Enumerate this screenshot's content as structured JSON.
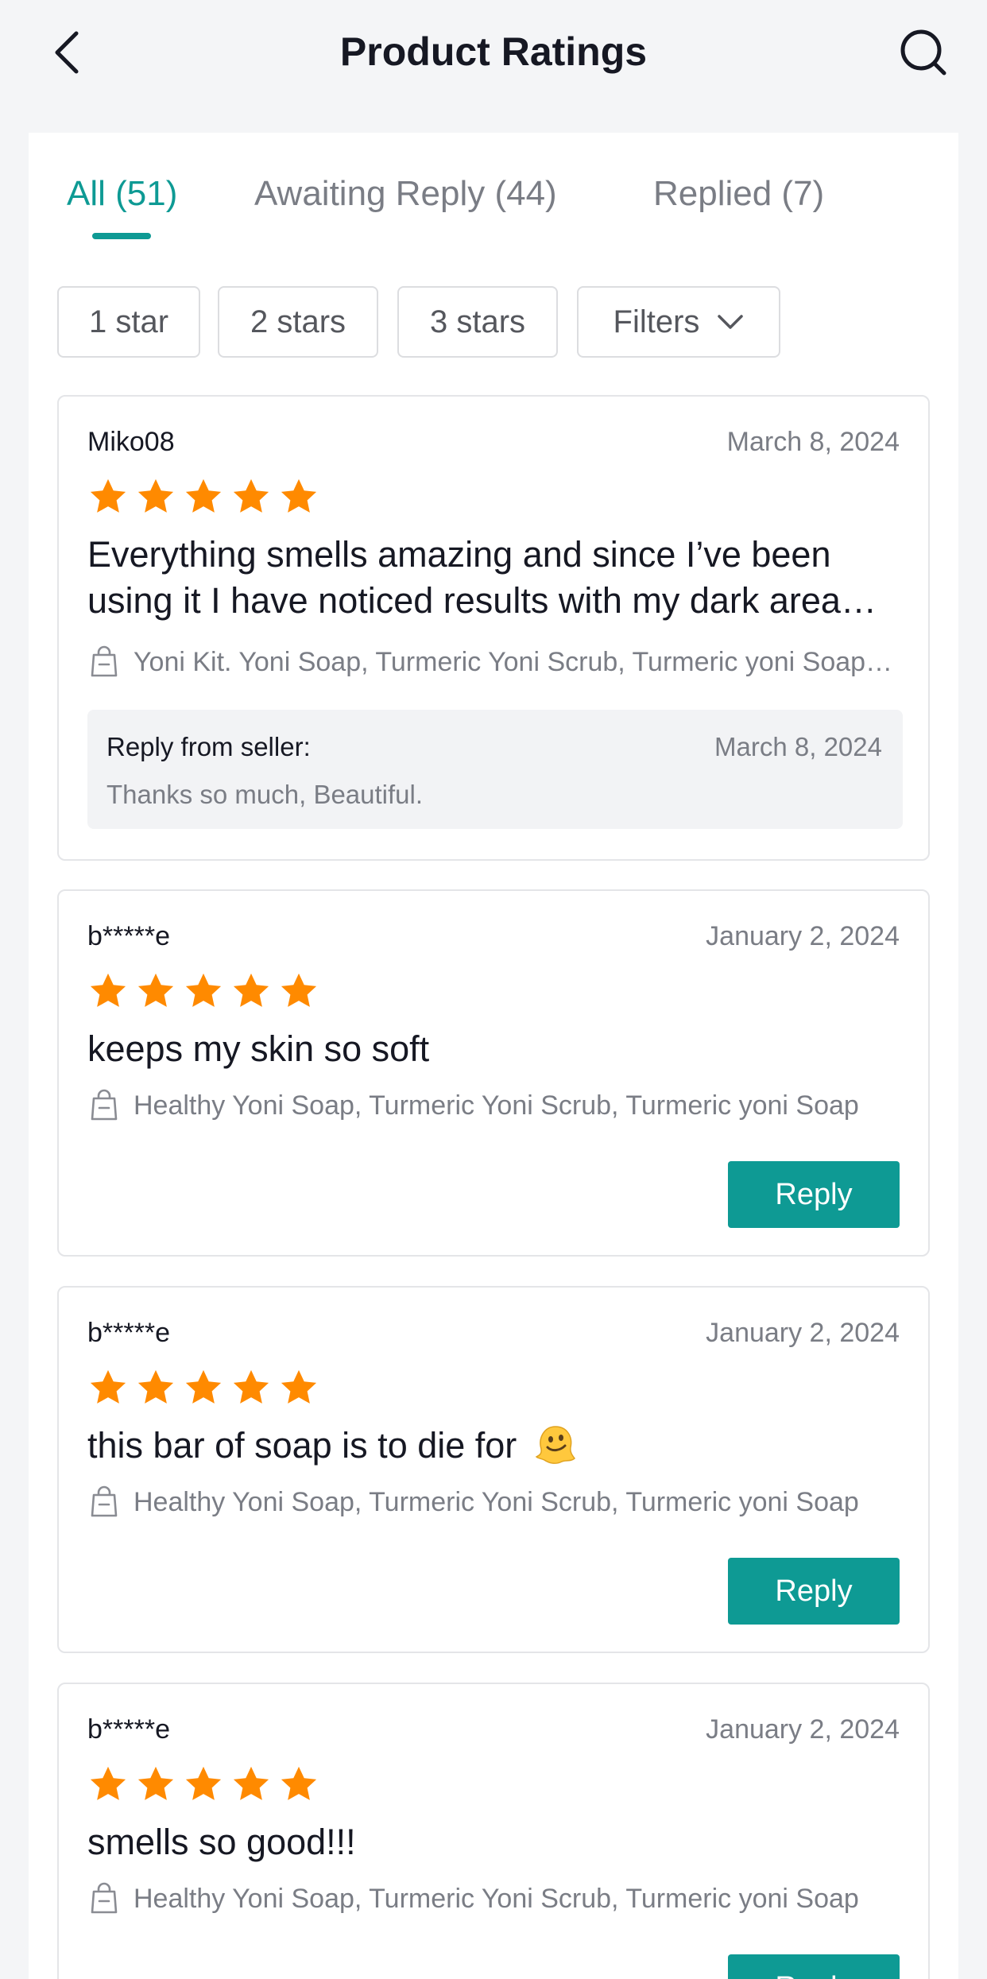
{
  "header": {
    "title": "Product Ratings",
    "back_icon": "chevron-left-icon",
    "search_icon": "search-icon"
  },
  "tabs": [
    {
      "label": "All (51)",
      "active": true
    },
    {
      "label": "Awaiting Reply (44)",
      "active": false
    },
    {
      "label": "Replied (7)",
      "active": false
    }
  ],
  "chips": [
    {
      "label": "1 star"
    },
    {
      "label": "2 stars"
    },
    {
      "label": "3 stars"
    },
    {
      "label": "Filters"
    }
  ],
  "colors": {
    "accent": "#0e9a94",
    "star": "#ff8a00",
    "muted_text": "#7a7d85"
  },
  "reviews": [
    {
      "user": "Miko08",
      "date": "March 8, 2024",
      "rating": 5,
      "text": "Everything smells amazing and since I’ve been using it I have noticed results with my dark area…",
      "products": "Yoni Kit.  Yoni Soap, Turmeric Yoni Scrub, Turmeric yoni Soap…",
      "reply": {
        "label": "Reply from seller:",
        "date": "March 8, 2024",
        "text": "Thanks so much, Beautiful."
      }
    },
    {
      "user": "b*****e",
      "date": "January 2, 2024",
      "rating": 5,
      "text": "keeps my skin so soft",
      "products": "Healthy Yoni Soap, Turmeric Yoni Scrub, Turmeric yoni Soap",
      "reply_button": "Reply"
    },
    {
      "user": "b*****e",
      "date": "January 2, 2024",
      "rating": 5,
      "text": "this bar of soap is to die for",
      "emoji": "melting-face-emoji",
      "products": "Healthy Yoni Soap, Turmeric Yoni Scrub, Turmeric yoni Soap",
      "reply_button": "Reply"
    },
    {
      "user": "b*****e",
      "date": "January 2, 2024",
      "rating": 5,
      "text": "smells so good!!!",
      "products": "Healthy Yoni Soap, Turmeric Yoni Scrub, Turmeric yoni Soap",
      "reply_button": "Reply"
    }
  ]
}
